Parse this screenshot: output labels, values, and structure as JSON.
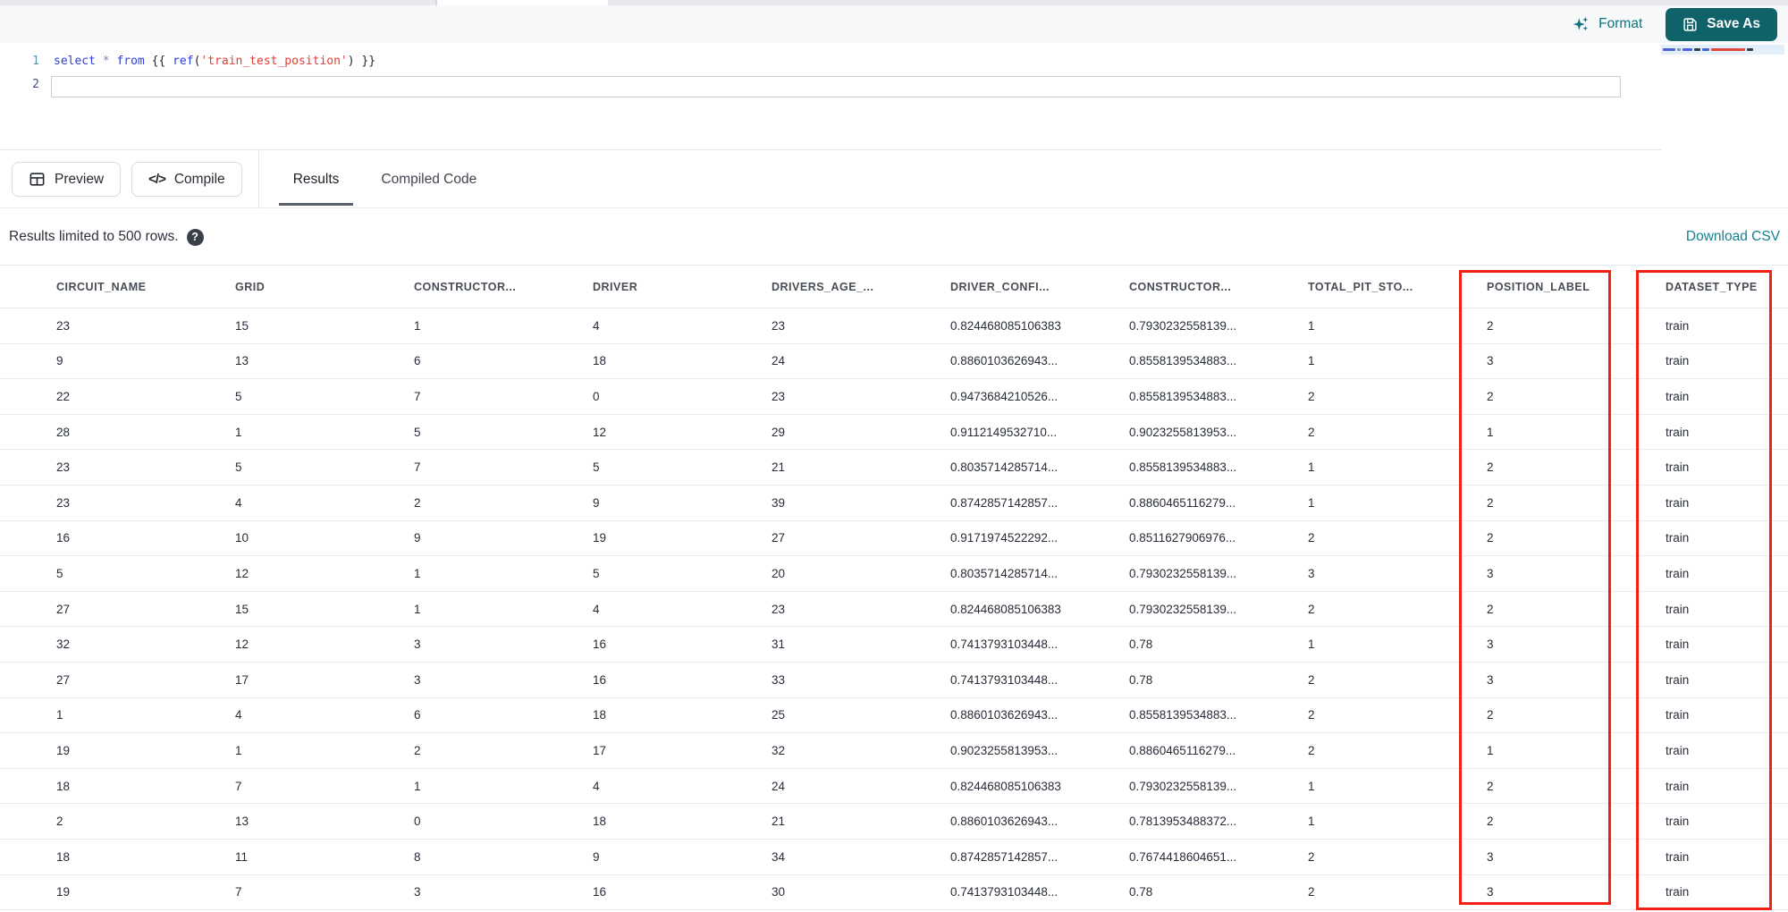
{
  "topbar": {
    "format_label": "Format",
    "save_as_label": "Save As"
  },
  "editor": {
    "line_numbers": [
      "1",
      "2"
    ],
    "code_line": "select * from {{ ref('train_test_position') }}",
    "tokens": [
      {
        "text": "select",
        "type": "keyword"
      },
      {
        "text": " ",
        "type": "plain"
      },
      {
        "text": "*",
        "type": "operator"
      },
      {
        "text": " ",
        "type": "plain"
      },
      {
        "text": "from",
        "type": "keyword"
      },
      {
        "text": " {{ ",
        "type": "plain"
      },
      {
        "text": "ref",
        "type": "keyword"
      },
      {
        "text": "(",
        "type": "plain"
      },
      {
        "text": "'train_test_position'",
        "type": "string"
      },
      {
        "text": ")",
        "type": "plain"
      },
      {
        "text": " }}",
        "type": "plain"
      }
    ]
  },
  "minimap": {
    "segments": [
      {
        "width": 14,
        "color": "#4a63d8"
      },
      {
        "width": 4,
        "color": "#8a94a8"
      },
      {
        "width": 11,
        "color": "#4a63d8"
      },
      {
        "width": 7,
        "color": "#333a45"
      },
      {
        "width": 8,
        "color": "#4a63d8"
      },
      {
        "width": 38,
        "color": "#e0483f"
      },
      {
        "width": 7,
        "color": "#333a45"
      }
    ]
  },
  "action_bar": {
    "preview_label": "Preview",
    "compile_label": "Compile",
    "compile_glyph": "</>"
  },
  "tabs": [
    {
      "label": "Results",
      "active": true
    },
    {
      "label": "Compiled Code",
      "active": false
    }
  ],
  "results_bar": {
    "message": "Results limited to 500 rows.",
    "help_glyph": "?",
    "download_label": "Download CSV"
  },
  "table": {
    "columns": [
      "CIRCUIT_NAME",
      "GRID",
      "CONSTRUCTOR...",
      "DRIVER",
      "DRIVERS_AGE_...",
      "DRIVER_CONFI...",
      "CONSTRUCTOR...",
      "TOTAL_PIT_STO...",
      "POSITION_LABEL",
      "DATASET_TYPE"
    ],
    "rows": [
      [
        "23",
        "15",
        "1",
        "4",
        "23",
        "0.824468085106383",
        "0.7930232558139...",
        "1",
        "2",
        "train"
      ],
      [
        "9",
        "13",
        "6",
        "18",
        "24",
        "0.8860103626943...",
        "0.8558139534883...",
        "1",
        "3",
        "train"
      ],
      [
        "22",
        "5",
        "7",
        "0",
        "23",
        "0.9473684210526...",
        "0.8558139534883...",
        "2",
        "2",
        "train"
      ],
      [
        "28",
        "1",
        "5",
        "12",
        "29",
        "0.9112149532710...",
        "0.9023255813953...",
        "2",
        "1",
        "train"
      ],
      [
        "23",
        "5",
        "7",
        "5",
        "21",
        "0.8035714285714...",
        "0.8558139534883...",
        "1",
        "2",
        "train"
      ],
      [
        "23",
        "4",
        "2",
        "9",
        "39",
        "0.8742857142857...",
        "0.8860465116279...",
        "1",
        "2",
        "train"
      ],
      [
        "16",
        "10",
        "9",
        "19",
        "27",
        "0.9171974522292...",
        "0.8511627906976...",
        "2",
        "2",
        "train"
      ],
      [
        "5",
        "12",
        "1",
        "5",
        "20",
        "0.8035714285714...",
        "0.7930232558139...",
        "3",
        "3",
        "train"
      ],
      [
        "27",
        "15",
        "1",
        "4",
        "23",
        "0.824468085106383",
        "0.7930232558139...",
        "2",
        "2",
        "train"
      ],
      [
        "32",
        "12",
        "3",
        "16",
        "31",
        "0.7413793103448...",
        "0.78",
        "1",
        "3",
        "train"
      ],
      [
        "27",
        "17",
        "3",
        "16",
        "33",
        "0.7413793103448...",
        "0.78",
        "2",
        "3",
        "train"
      ],
      [
        "1",
        "4",
        "6",
        "18",
        "25",
        "0.8860103626943...",
        "0.8558139534883...",
        "2",
        "2",
        "train"
      ],
      [
        "19",
        "1",
        "2",
        "17",
        "32",
        "0.9023255813953...",
        "0.8860465116279...",
        "2",
        "1",
        "train"
      ],
      [
        "18",
        "7",
        "1",
        "4",
        "24",
        "0.824468085106383",
        "0.7930232558139...",
        "1",
        "2",
        "train"
      ],
      [
        "2",
        "13",
        "0",
        "18",
        "21",
        "0.8860103626943...",
        "0.7813953488372...",
        "1",
        "2",
        "train"
      ],
      [
        "18",
        "11",
        "8",
        "9",
        "34",
        "0.8742857142857...",
        "0.7674418604651...",
        "2",
        "3",
        "train"
      ],
      [
        "19",
        "7",
        "3",
        "16",
        "30",
        "0.7413793103448...",
        "0.78",
        "2",
        "3",
        "train"
      ]
    ]
  },
  "annotations": {
    "color": "#f32013",
    "boxes": [
      "position-label-column",
      "dataset-type-column"
    ]
  },
  "colors": {
    "accent_teal": "#11737e",
    "save_button": "#0f616a",
    "annotation_red": "#f32013",
    "keyword_blue": "#2d3fd3",
    "string_red": "#df3e36"
  }
}
